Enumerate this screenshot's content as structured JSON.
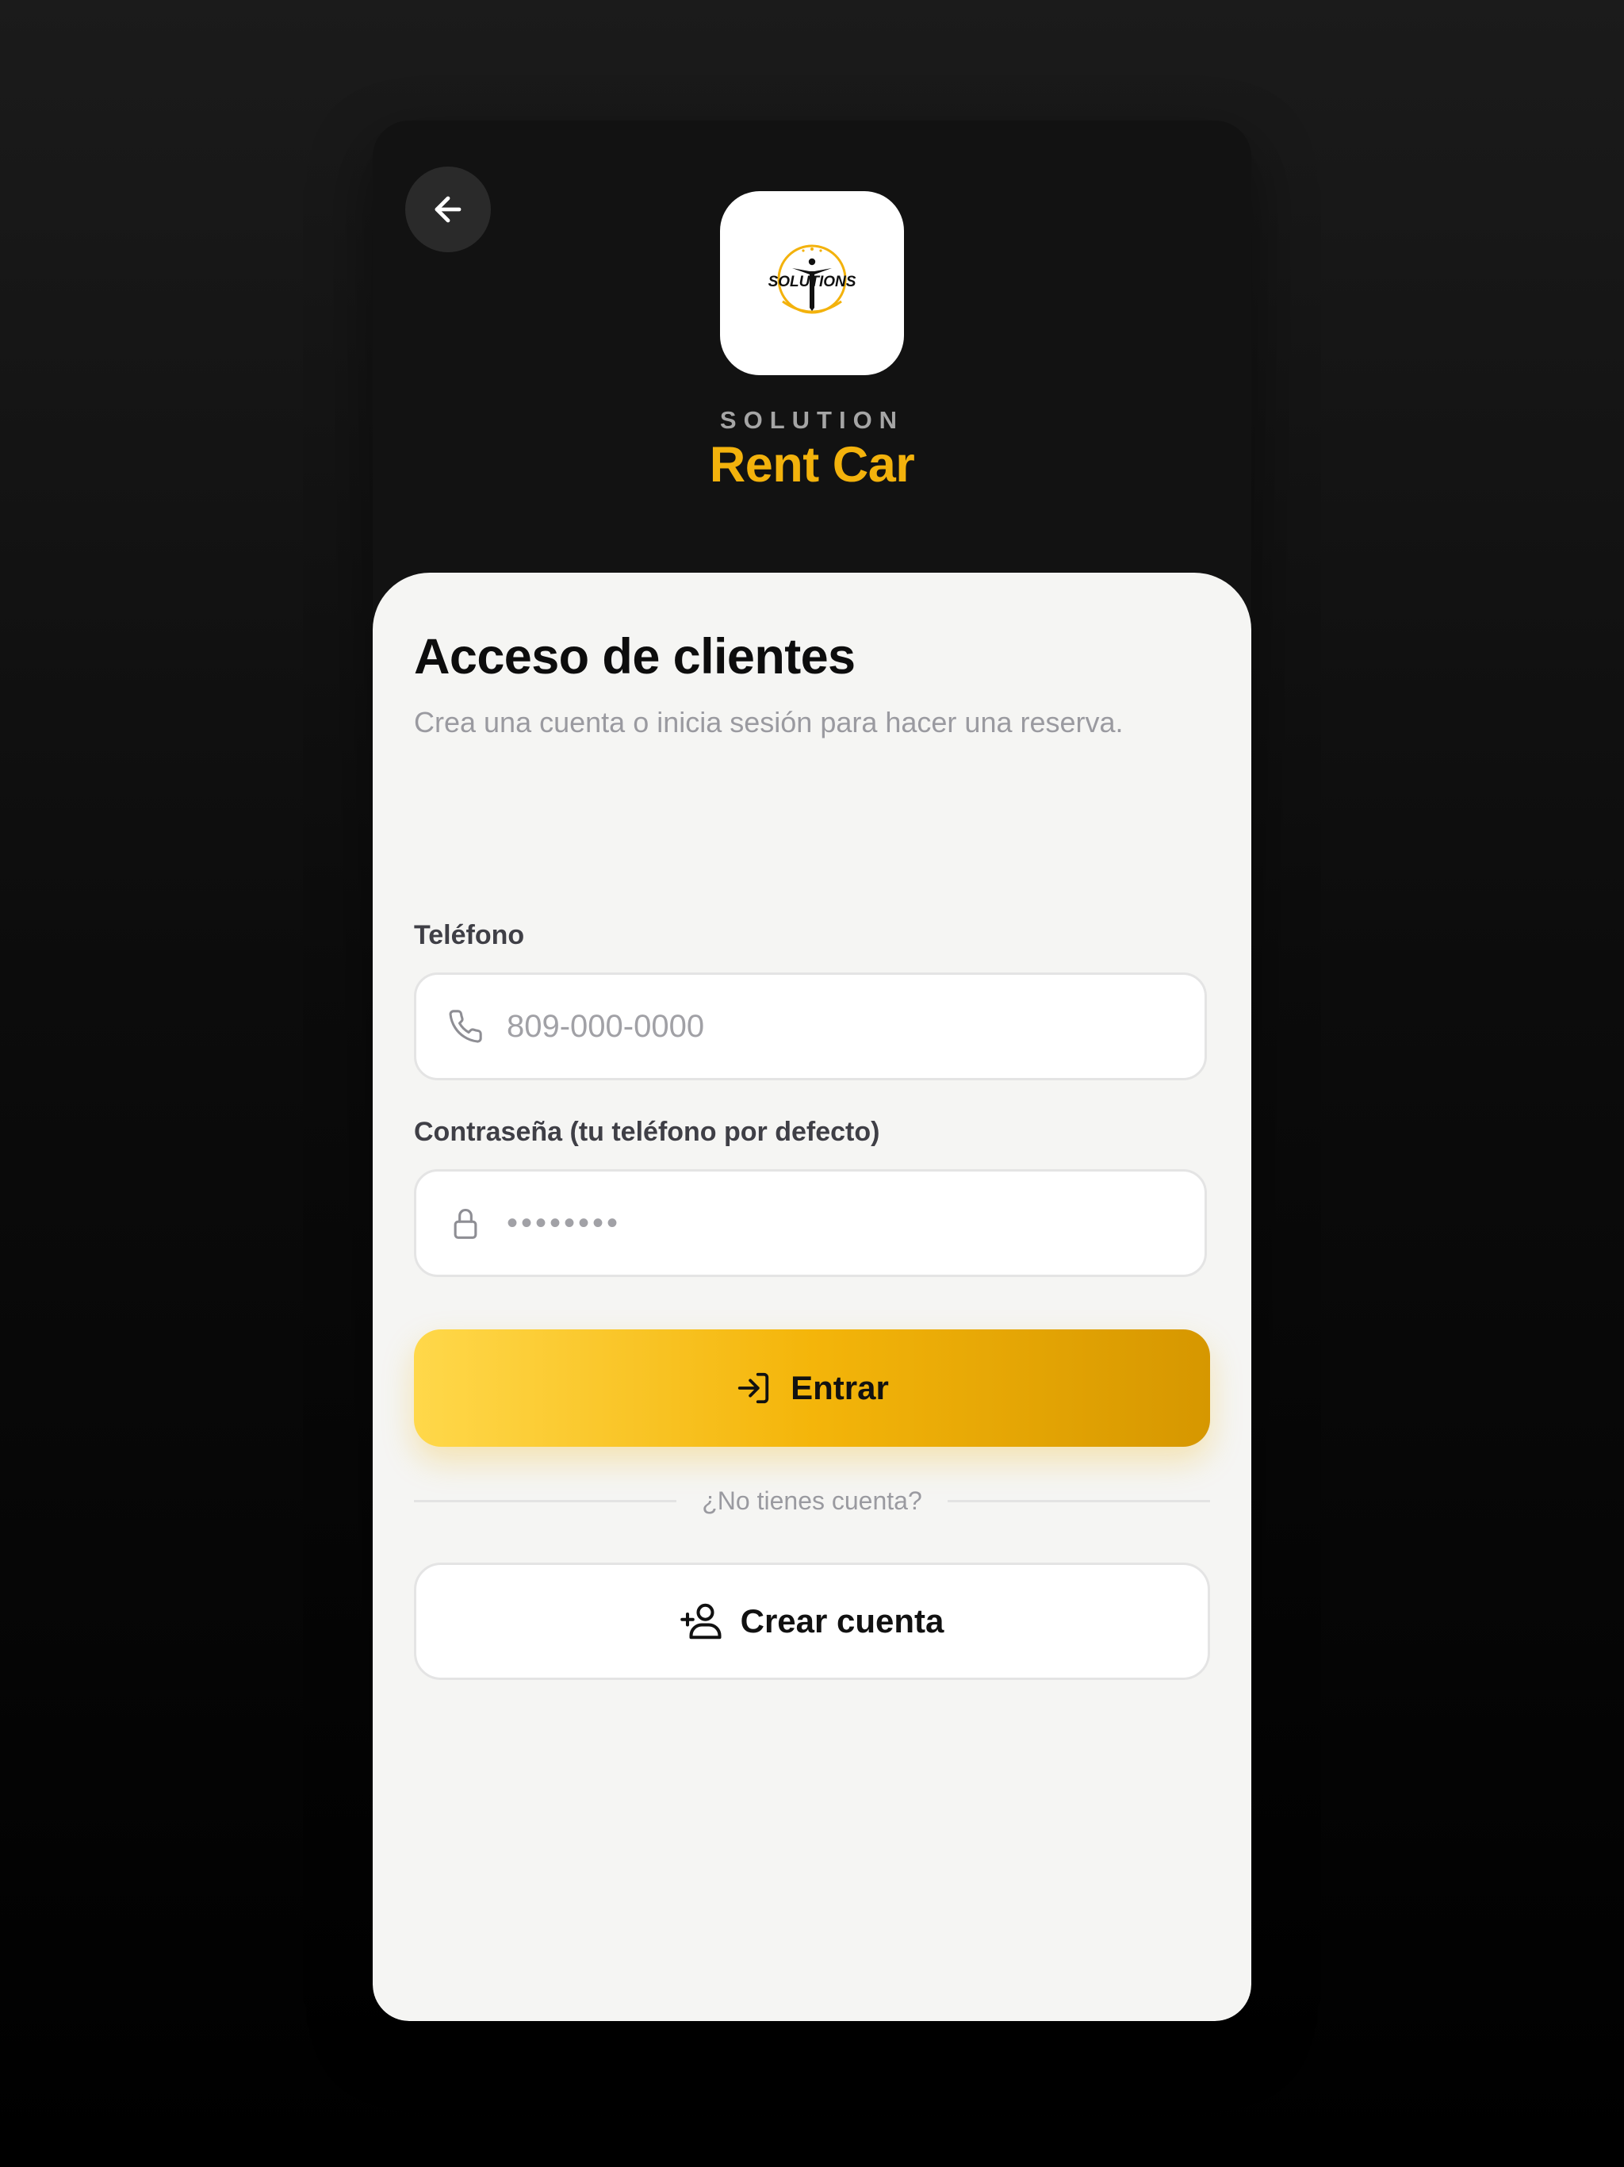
{
  "header": {
    "back_icon": "arrow-left-icon",
    "logo_text": "SOLUTIONS",
    "brand_eyebrow": "SOLUTION",
    "brand_name": "Rent Car",
    "accent_color": "#f3b20c"
  },
  "login": {
    "title": "Acceso de clientes",
    "subtitle": "Crea una cuenta o inicia sesión para hacer una reserva.",
    "phone": {
      "label": "Teléfono",
      "placeholder": "809-000-0000",
      "icon": "phone-icon"
    },
    "password": {
      "label": "Contraseña (tu teléfono por defecto)",
      "placeholder": "••••••••",
      "icon": "lock-icon"
    },
    "submit": {
      "label": "Entrar",
      "icon": "login-icon"
    },
    "divider_text": "¿No tienes cuenta?",
    "create": {
      "label": "Crear cuenta",
      "icon": "user-plus-icon"
    }
  }
}
